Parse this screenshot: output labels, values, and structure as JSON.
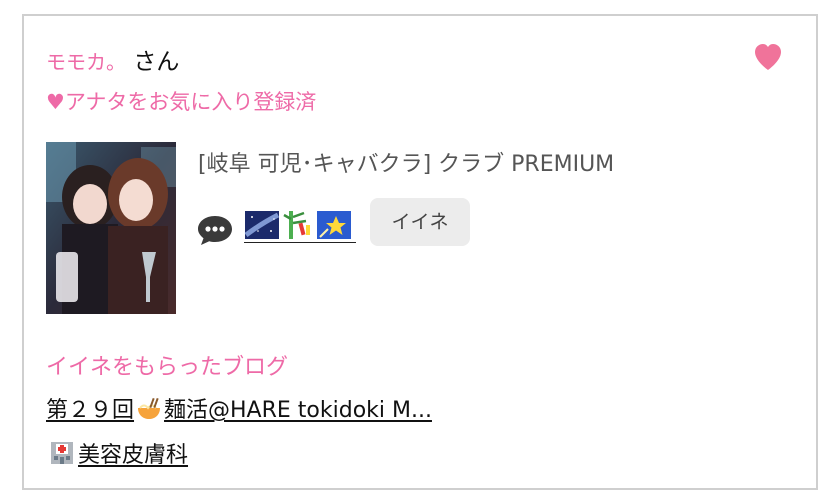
{
  "user": {
    "nickname": "モモカ。",
    "honorific": "さん"
  },
  "favorite": {
    "heart_glyph": "♥",
    "text": "アナタをお気に入り登録済",
    "heart_color": "#f0739a"
  },
  "cast": {
    "shop": "[岐阜 可児･キャバクラ]  クラブ PREMIUM",
    "iine_label": "イイネ"
  },
  "blog": {
    "heading": "イイネをもらったブログ",
    "links": [
      {
        "prefix": "第２９回",
        "icon": "ramen-bowl-icon",
        "suffix": "麺活@HARE tokidoki M..."
      },
      {
        "icon": "hospital-icon",
        "text": "美容皮膚科"
      }
    ]
  },
  "colors": {
    "accent_pink": "#ee6aa7",
    "button_gray": "#ececec",
    "border": "#cfcfcf"
  }
}
